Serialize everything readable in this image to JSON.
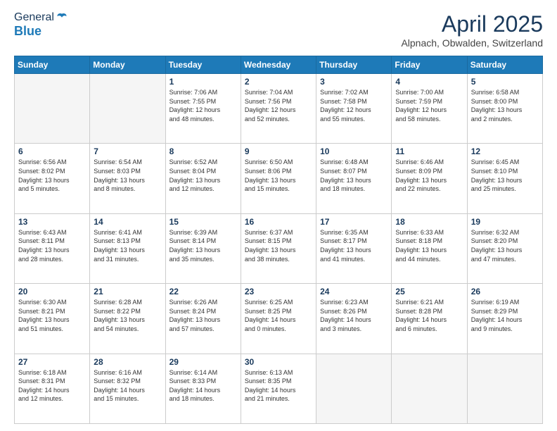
{
  "header": {
    "logo_line1": "General",
    "logo_line2": "Blue",
    "month": "April 2025",
    "location": "Alpnach, Obwalden, Switzerland"
  },
  "weekdays": [
    "Sunday",
    "Monday",
    "Tuesday",
    "Wednesday",
    "Thursday",
    "Friday",
    "Saturday"
  ],
  "weeks": [
    [
      {
        "day": "",
        "content": ""
      },
      {
        "day": "",
        "content": ""
      },
      {
        "day": "1",
        "content": "Sunrise: 7:06 AM\nSunset: 7:55 PM\nDaylight: 12 hours\nand 48 minutes."
      },
      {
        "day": "2",
        "content": "Sunrise: 7:04 AM\nSunset: 7:56 PM\nDaylight: 12 hours\nand 52 minutes."
      },
      {
        "day": "3",
        "content": "Sunrise: 7:02 AM\nSunset: 7:58 PM\nDaylight: 12 hours\nand 55 minutes."
      },
      {
        "day": "4",
        "content": "Sunrise: 7:00 AM\nSunset: 7:59 PM\nDaylight: 12 hours\nand 58 minutes."
      },
      {
        "day": "5",
        "content": "Sunrise: 6:58 AM\nSunset: 8:00 PM\nDaylight: 13 hours\nand 2 minutes."
      }
    ],
    [
      {
        "day": "6",
        "content": "Sunrise: 6:56 AM\nSunset: 8:02 PM\nDaylight: 13 hours\nand 5 minutes."
      },
      {
        "day": "7",
        "content": "Sunrise: 6:54 AM\nSunset: 8:03 PM\nDaylight: 13 hours\nand 8 minutes."
      },
      {
        "day": "8",
        "content": "Sunrise: 6:52 AM\nSunset: 8:04 PM\nDaylight: 13 hours\nand 12 minutes."
      },
      {
        "day": "9",
        "content": "Sunrise: 6:50 AM\nSunset: 8:06 PM\nDaylight: 13 hours\nand 15 minutes."
      },
      {
        "day": "10",
        "content": "Sunrise: 6:48 AM\nSunset: 8:07 PM\nDaylight: 13 hours\nand 18 minutes."
      },
      {
        "day": "11",
        "content": "Sunrise: 6:46 AM\nSunset: 8:09 PM\nDaylight: 13 hours\nand 22 minutes."
      },
      {
        "day": "12",
        "content": "Sunrise: 6:45 AM\nSunset: 8:10 PM\nDaylight: 13 hours\nand 25 minutes."
      }
    ],
    [
      {
        "day": "13",
        "content": "Sunrise: 6:43 AM\nSunset: 8:11 PM\nDaylight: 13 hours\nand 28 minutes."
      },
      {
        "day": "14",
        "content": "Sunrise: 6:41 AM\nSunset: 8:13 PM\nDaylight: 13 hours\nand 31 minutes."
      },
      {
        "day": "15",
        "content": "Sunrise: 6:39 AM\nSunset: 8:14 PM\nDaylight: 13 hours\nand 35 minutes."
      },
      {
        "day": "16",
        "content": "Sunrise: 6:37 AM\nSunset: 8:15 PM\nDaylight: 13 hours\nand 38 minutes."
      },
      {
        "day": "17",
        "content": "Sunrise: 6:35 AM\nSunset: 8:17 PM\nDaylight: 13 hours\nand 41 minutes."
      },
      {
        "day": "18",
        "content": "Sunrise: 6:33 AM\nSunset: 8:18 PM\nDaylight: 13 hours\nand 44 minutes."
      },
      {
        "day": "19",
        "content": "Sunrise: 6:32 AM\nSunset: 8:20 PM\nDaylight: 13 hours\nand 47 minutes."
      }
    ],
    [
      {
        "day": "20",
        "content": "Sunrise: 6:30 AM\nSunset: 8:21 PM\nDaylight: 13 hours\nand 51 minutes."
      },
      {
        "day": "21",
        "content": "Sunrise: 6:28 AM\nSunset: 8:22 PM\nDaylight: 13 hours\nand 54 minutes."
      },
      {
        "day": "22",
        "content": "Sunrise: 6:26 AM\nSunset: 8:24 PM\nDaylight: 13 hours\nand 57 minutes."
      },
      {
        "day": "23",
        "content": "Sunrise: 6:25 AM\nSunset: 8:25 PM\nDaylight: 14 hours\nand 0 minutes."
      },
      {
        "day": "24",
        "content": "Sunrise: 6:23 AM\nSunset: 8:26 PM\nDaylight: 14 hours\nand 3 minutes."
      },
      {
        "day": "25",
        "content": "Sunrise: 6:21 AM\nSunset: 8:28 PM\nDaylight: 14 hours\nand 6 minutes."
      },
      {
        "day": "26",
        "content": "Sunrise: 6:19 AM\nSunset: 8:29 PM\nDaylight: 14 hours\nand 9 minutes."
      }
    ],
    [
      {
        "day": "27",
        "content": "Sunrise: 6:18 AM\nSunset: 8:31 PM\nDaylight: 14 hours\nand 12 minutes."
      },
      {
        "day": "28",
        "content": "Sunrise: 6:16 AM\nSunset: 8:32 PM\nDaylight: 14 hours\nand 15 minutes."
      },
      {
        "day": "29",
        "content": "Sunrise: 6:14 AM\nSunset: 8:33 PM\nDaylight: 14 hours\nand 18 minutes."
      },
      {
        "day": "30",
        "content": "Sunrise: 6:13 AM\nSunset: 8:35 PM\nDaylight: 14 hours\nand 21 minutes."
      },
      {
        "day": "",
        "content": ""
      },
      {
        "day": "",
        "content": ""
      },
      {
        "day": "",
        "content": ""
      }
    ]
  ]
}
